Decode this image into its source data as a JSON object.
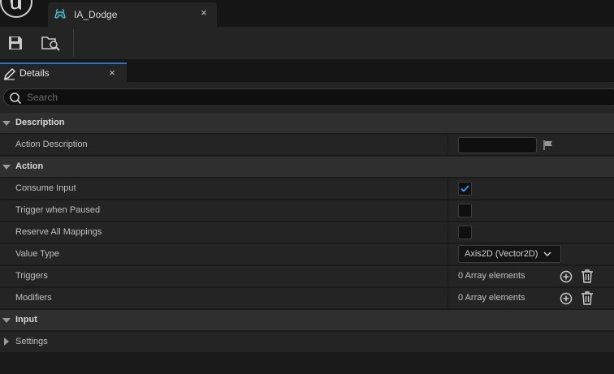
{
  "asset_tab": {
    "label": "IA_Dodge",
    "icon": "input-action-icon",
    "close": "×"
  },
  "toolbar": {
    "save_icon": "save-icon",
    "browse_icon": "browse-asset-icon"
  },
  "details_tab": {
    "label": "Details",
    "icon": "pencil-icon",
    "close": "×"
  },
  "search": {
    "placeholder": "Search",
    "value": ""
  },
  "categories": {
    "description": "Description",
    "action": "Action",
    "input": "Input",
    "settings": "Settings"
  },
  "properties": {
    "action_description": {
      "label": "Action Description",
      "value": ""
    },
    "consume_input": {
      "label": "Consume Input",
      "checked": true
    },
    "trigger_when_paused": {
      "label": "Trigger when Paused",
      "checked": false
    },
    "reserve_all_mappings": {
      "label": "Reserve All Mappings",
      "checked": false
    },
    "value_type": {
      "label": "Value Type",
      "value": "Axis2D (Vector2D)"
    },
    "triggers": {
      "label": "Triggers",
      "value": "0 Array elements"
    },
    "modifiers": {
      "label": "Modifiers",
      "value": "0 Array elements"
    }
  },
  "colors": {
    "accent": "#2a6fc0",
    "checkmark": "#3d8fe8",
    "asset_icon": "#4fc4d8",
    "panel_bg": "#242424",
    "category_bg": "#2f2f2f"
  }
}
